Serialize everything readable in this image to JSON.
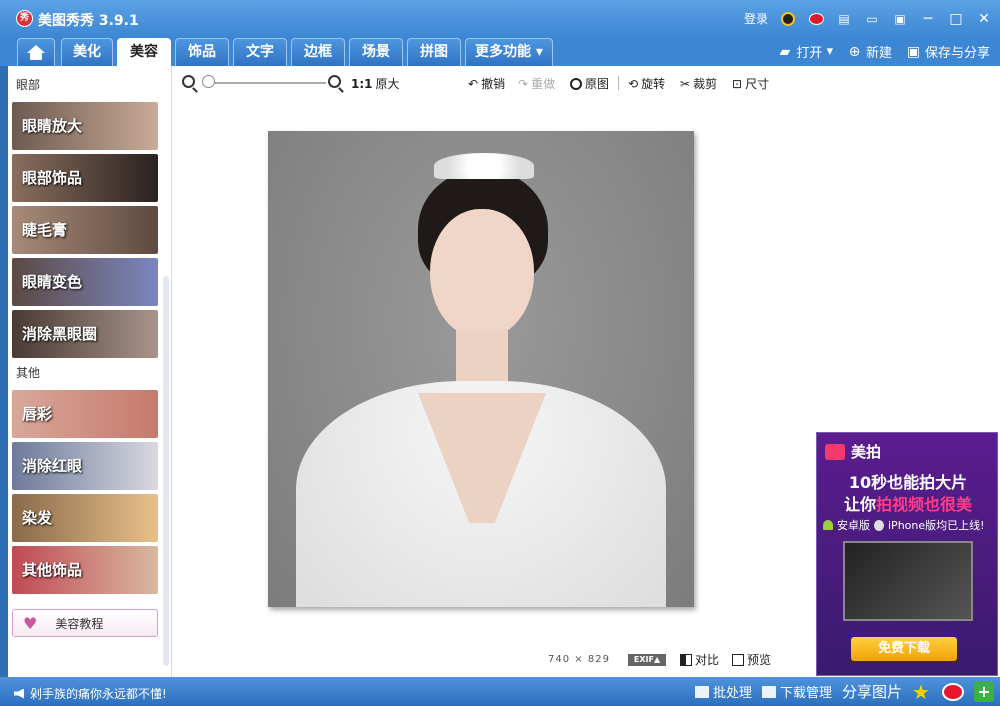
{
  "app": {
    "logo_text": "秀",
    "title": "美图秀秀 3.9.1"
  },
  "titlebar": {
    "login": "登录",
    "icons": [
      "qq-icon",
      "weibo-icon",
      "skin-icon",
      "message-icon",
      "feedback-icon"
    ],
    "window_controls": [
      "─",
      "□",
      "✕"
    ]
  },
  "nav": {
    "tabs": [
      {
        "label": "美化"
      },
      {
        "label": "美容"
      },
      {
        "label": "饰品"
      },
      {
        "label": "文字"
      },
      {
        "label": "边框"
      },
      {
        "label": "场景"
      },
      {
        "label": "拼图"
      },
      {
        "label": "更多功能 ▾"
      }
    ],
    "active_tab": "美容",
    "open": "打开",
    "new": "新建",
    "save_share": "保存与分享"
  },
  "leftpanel": {
    "section_eyes": "眼部",
    "eye_items": [
      {
        "label": "眼睛放大",
        "bg": "#b89a86"
      },
      {
        "label": "眼部饰品",
        "bg": "#3b2f2a"
      },
      {
        "label": "睫毛膏",
        "bg": "#8b6f5e"
      },
      {
        "label": "眼睛变色",
        "bg": "#5a5f8a"
      },
      {
        "label": "消除黑眼圈",
        "bg": "#6c5a52"
      }
    ],
    "section_other": "其他",
    "other_items": [
      {
        "label": "唇彩",
        "bg": "#c98a7e"
      },
      {
        "label": "消除红眼",
        "bg": "#8a8aa0"
      },
      {
        "label": "染发",
        "bg": "#c89a6a"
      },
      {
        "label": "其他饰品",
        "bg": "#b94a52"
      }
    ],
    "tutorial": "美容教程"
  },
  "toolbar": {
    "ratio": "1:1",
    "original_size": "原大",
    "undo": "撤销",
    "redo": "重做",
    "original_image": "原图",
    "rotate": "旋转",
    "crop": "裁剪",
    "resize": "尺寸"
  },
  "image": {
    "width_text": "740",
    "times": "×",
    "height_text": "829",
    "exif": "EXIF▲"
  },
  "bottom_tools": {
    "compare": "对比",
    "preview": "预览"
  },
  "ad": {
    "brand": "美拍",
    "headline": "10秒也能拍大片",
    "sub_prefix": "让你",
    "sub_highlight": "拍视频也很美",
    "platform_android": "安卓版",
    "platform_iphone": "iPhone版均已上线!",
    "cta": "免费下载"
  },
  "status": {
    "message": "剁手族的痛你永远都不懂!",
    "batch": "批处理",
    "download_manager": "下载管理",
    "share_image": "分享图片"
  },
  "colors": {
    "titlebar": "#3d86d4",
    "accent_pink": "#ff3c86",
    "cta_yellow": "#f2a007"
  }
}
